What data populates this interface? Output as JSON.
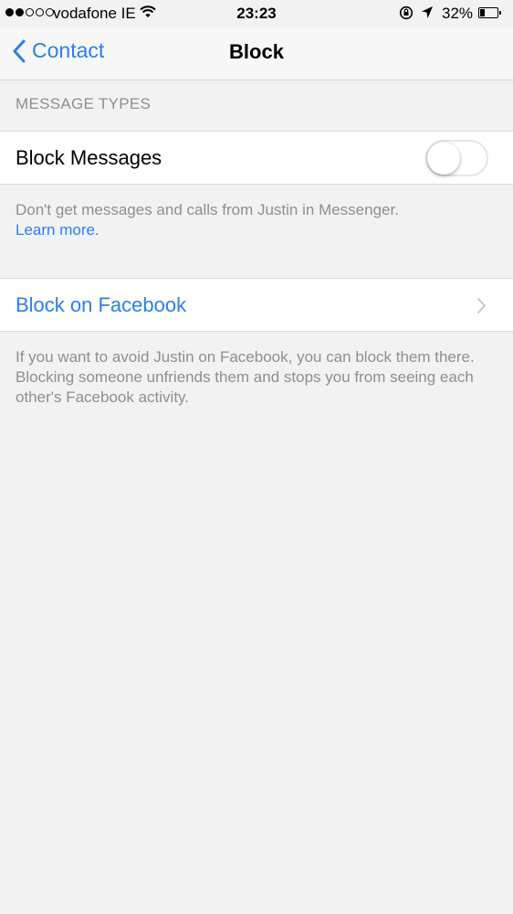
{
  "status_bar": {
    "carrier": "vodafone IE",
    "time": "23:23",
    "battery_percent": "32%",
    "battery_level": 0.32,
    "signal_bars_filled": 2,
    "signal_bars_total": 5
  },
  "nav": {
    "back_label": "Contact",
    "title": "Block"
  },
  "section_message_types": {
    "header": "MESSAGE TYPES",
    "block_messages_label": "Block Messages",
    "block_messages_enabled": false,
    "footer_text": "Don't get messages and calls from Justin in Messenger.",
    "footer_link": "Learn more."
  },
  "section_facebook": {
    "block_on_facebook_label": "Block on Facebook",
    "footer_text": "If you want to avoid Justin on Facebook, you can block them there. Blocking someone unfriends them and stops you from seeing each other's Facebook activity."
  },
  "colors": {
    "accent": "#2a7ff0",
    "background": "#f2f2f2",
    "secondary_text": "#8e8e93"
  },
  "icons": {
    "back": "chevron-left-icon",
    "disclosure": "chevron-right-icon",
    "wifi": "wifi-icon",
    "rotation_lock": "rotation-lock-icon",
    "location": "location-arrow-icon",
    "battery": "battery-icon"
  }
}
